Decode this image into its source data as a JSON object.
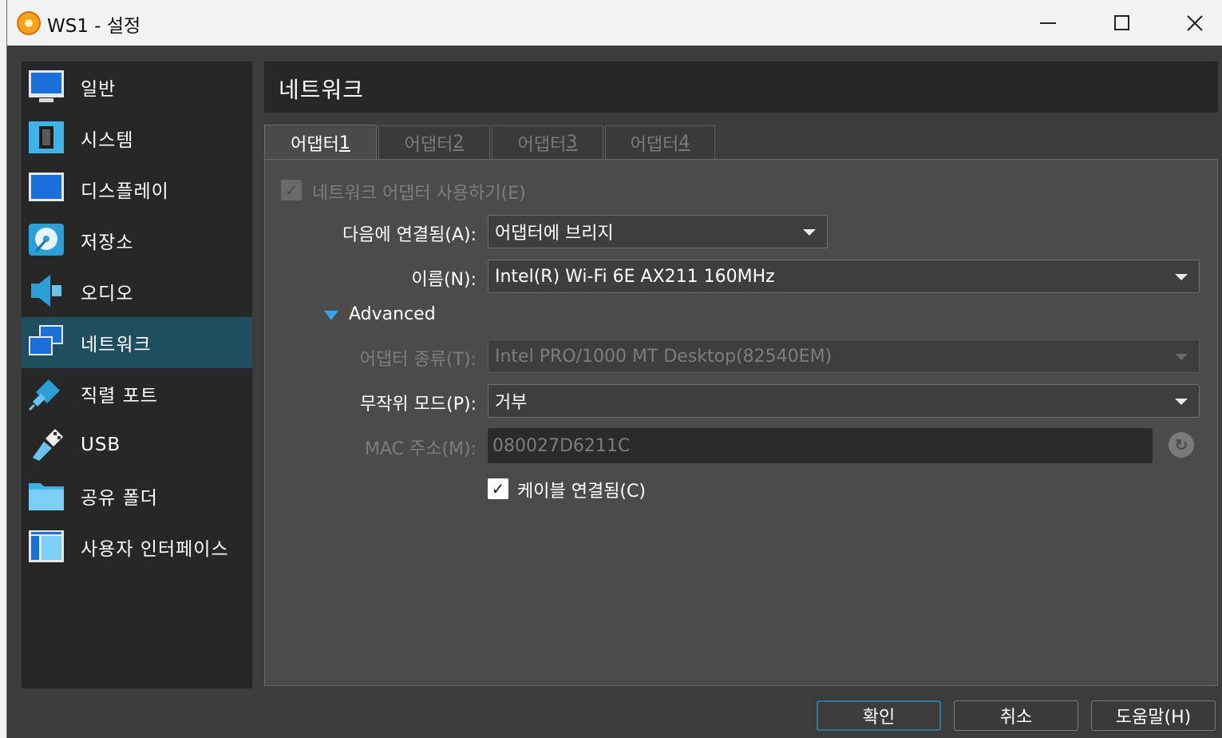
{
  "window": {
    "title": "WS1 - 설정",
    "controls": {
      "minimize": "minimize",
      "maximize": "maximize",
      "close": "close"
    }
  },
  "sidebar": {
    "items": [
      {
        "label": "일반",
        "icon": "monitor-icon"
      },
      {
        "label": "시스템",
        "icon": "chip-icon"
      },
      {
        "label": "디스플레이",
        "icon": "display-icon"
      },
      {
        "label": "저장소",
        "icon": "disk-icon"
      },
      {
        "label": "오디오",
        "icon": "speaker-icon"
      },
      {
        "label": "네트워크",
        "icon": "network-icon",
        "active": true
      },
      {
        "label": "직렬 포트",
        "icon": "serial-port-icon"
      },
      {
        "label": "USB",
        "icon": "usb-icon"
      },
      {
        "label": "공유 폴더",
        "icon": "folder-icon"
      },
      {
        "label": "사용자 인터페이스",
        "icon": "ui-icon"
      }
    ]
  },
  "header": {
    "title": "네트워크"
  },
  "tabs": [
    {
      "label": "어댑터 ",
      "num": "1",
      "active": true
    },
    {
      "label": "어댑터 ",
      "num": "2"
    },
    {
      "label": "어댑터 ",
      "num": "3"
    },
    {
      "label": "어댑터 ",
      "num": "4"
    }
  ],
  "form": {
    "enable_checkbox_label": "네트워크 어댑터 사용하기(E)",
    "attached_label": "다음에 연결됨(A):",
    "attached_value": "어댑터에 브리지",
    "name_label": "이름(N):",
    "name_value": "Intel(R) Wi-Fi 6E AX211 160MHz",
    "advanced_label": "Advanced",
    "adapter_type_label": "어댑터 종류(T):",
    "adapter_type_value": "Intel PRO/1000 MT Desktop(82540EM)",
    "promisc_label": "무작위 모드(P):",
    "promisc_value": "거부",
    "mac_label": "MAC 주소(M):",
    "mac_value": "080027D6211C",
    "cable_label": "케이블 연결됨(C)"
  },
  "buttons": {
    "ok": "확인",
    "cancel": "취소",
    "help": "도움말(H)"
  }
}
